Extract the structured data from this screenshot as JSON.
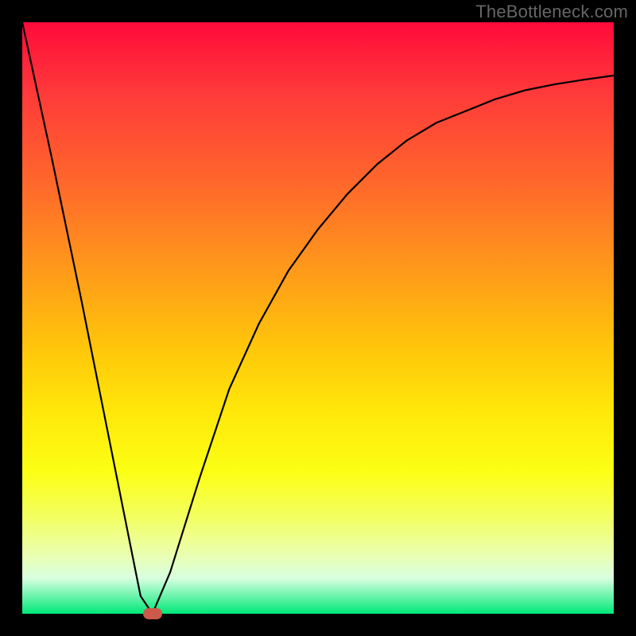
{
  "watermark": "TheBottleneck.com",
  "chart_data": {
    "type": "line",
    "title": "",
    "xlabel": "",
    "ylabel": "",
    "xlim": [
      0,
      100
    ],
    "ylim": [
      0,
      100
    ],
    "grid": false,
    "series": [
      {
        "name": "bottleneck-curve",
        "x": [
          0,
          5,
          10,
          15,
          18,
          20,
          22,
          25,
          30,
          35,
          40,
          45,
          50,
          55,
          60,
          65,
          70,
          75,
          80,
          85,
          90,
          95,
          100
        ],
        "values": [
          100,
          77,
          53,
          28,
          13,
          3,
          0,
          7,
          23,
          38,
          49,
          58,
          65,
          71,
          76,
          80,
          83,
          85,
          87,
          88.5,
          89.5,
          90.3,
          91
        ]
      }
    ],
    "marker": {
      "x": 22,
      "y": 0
    },
    "background_gradient": {
      "top": "#ff0a3a",
      "mid": "#ffe80a",
      "bottom": "#00e878"
    }
  }
}
